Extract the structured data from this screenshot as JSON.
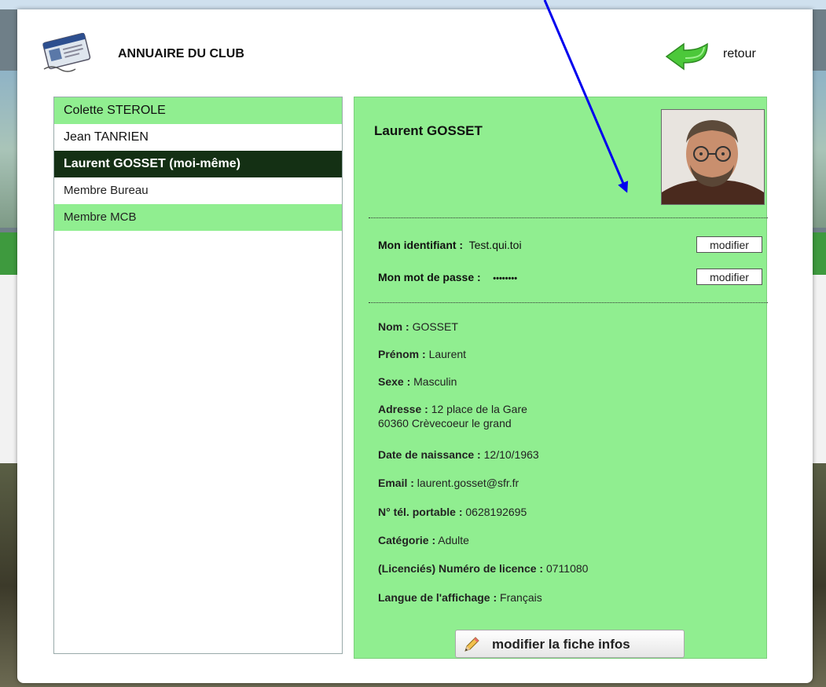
{
  "header": {
    "title": "ANNUAIRE DU CLUB",
    "back_label": "retour"
  },
  "members": [
    {
      "label": "Colette STEROLE",
      "style": "green"
    },
    {
      "label": "Jean TANRIEN",
      "style": "white"
    },
    {
      "label": "Laurent GOSSET (moi-même)",
      "style": "selected"
    },
    {
      "label": "Membre Bureau",
      "style": "white small"
    },
    {
      "label": "Membre MCB",
      "style": "green small"
    }
  ],
  "profile": {
    "name": "Laurent GOSSET",
    "credentials": {
      "id_label": "Mon identifiant :",
      "id_value": "Test.qui.toi",
      "pwd_label": "Mon mot de passe :",
      "pwd_value": "••••••••",
      "modify_label": "modifier"
    },
    "fields": [
      {
        "key": "Nom :",
        "value": "GOSSET"
      },
      {
        "key": "Prénom :",
        "value": "Laurent"
      },
      {
        "key": "Sexe :",
        "value": "Masculin"
      },
      {
        "key": "Adresse :",
        "value": "12 place de la Gare",
        "value2": "60360 Crèvecoeur le grand"
      },
      {
        "key": "Date de naissance :",
        "value": "12/10/1963"
      },
      {
        "key": "Email :",
        "value": "laurent.gosset@sfr.fr"
      },
      {
        "key": "N° tél. portable :",
        "value": "0628192695"
      },
      {
        "key": "Catégorie :",
        "value": "Adulte"
      },
      {
        "key": "(Licenciés) Numéro de licence :",
        "value": "0711080"
      },
      {
        "key": "Langue de l'affichage :",
        "value": "Français"
      }
    ],
    "edit_button": "modifier la fiche infos"
  },
  "colors": {
    "panel_green": "#90ee90",
    "selected_dark": "#143014",
    "arrow_blue": "#0000ee"
  }
}
